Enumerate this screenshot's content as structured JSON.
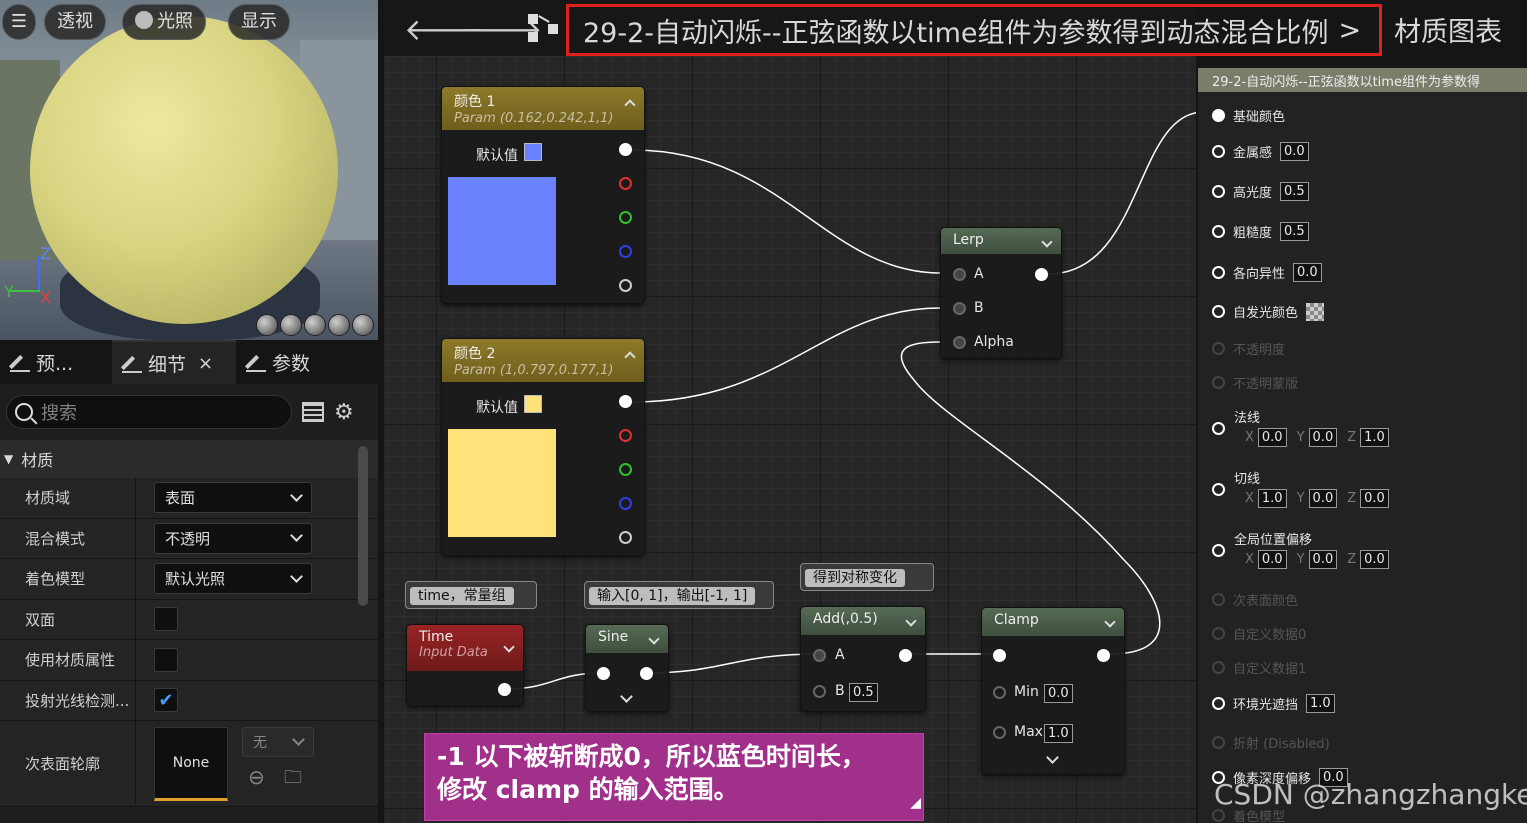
{
  "viewport": {
    "buttons": [
      "透视",
      "光照",
      "显示"
    ],
    "axis": {
      "z": "Z",
      "y": "Y",
      "x": "X"
    }
  },
  "panel": {
    "tabs": [
      {
        "label": "预..."
      },
      {
        "label": "细节"
      },
      {
        "label": "参数"
      }
    ],
    "search_placeholder": "搜索",
    "section": "材质",
    "props": [
      {
        "label": "材质域",
        "value": "表面"
      },
      {
        "label": "混合模式",
        "value": "不透明"
      },
      {
        "label": "着色模型",
        "value": "默认光照"
      },
      {
        "label": "双面",
        "checked": false
      },
      {
        "label": "使用材质属性",
        "checked": false
      },
      {
        "label": "投射光线检测...",
        "checked": true
      },
      {
        "label": "次表面轮廓",
        "value": "None",
        "combo": "无"
      }
    ]
  },
  "topbar": {
    "breadcrumb": "29-2-自动闪烁--正弦函数以time组件为参数得到动态混合比例",
    "separator": ">",
    "graph_label": "材质图表"
  },
  "nodes": {
    "color1": {
      "title": "颜色 1",
      "subtitle": "Param (0.162,0.242,1,1)",
      "default_label": "默认值",
      "color": "#6b82ff"
    },
    "color2": {
      "title": "颜色 2",
      "subtitle": "Param (1,0.797,0.177,1)",
      "default_label": "默认值",
      "color": "#ffe37a"
    },
    "lerp": {
      "title": "Lerp",
      "pins": [
        "A",
        "B",
        "Alpha"
      ]
    },
    "time": {
      "title": "Time",
      "subtitle": "Input Data",
      "comment": "time，常量组"
    },
    "sine": {
      "title": "Sine",
      "comment": "输入[0, 1]，输出[-1, 1]"
    },
    "add": {
      "title": "Add(,0.5)",
      "comment": "得到对称变化",
      "pin_a": "A",
      "pin_b": "B",
      "b_value": "0.5"
    },
    "clamp": {
      "title": "Clamp",
      "min_label": "Min",
      "min_value": "0.0",
      "max_label": "Max",
      "max_value": "1.0"
    }
  },
  "result": {
    "title": "29-2-自动闪烁--正弦函数以time组件为参数得",
    "pins": [
      {
        "label": "基础颜色"
      },
      {
        "label": "金属感",
        "value": "0.0"
      },
      {
        "label": "高光度",
        "value": "0.5"
      },
      {
        "label": "粗糙度",
        "value": "0.5"
      },
      {
        "label": "各向异性",
        "value": "0.0"
      },
      {
        "label": "自发光颜色"
      },
      {
        "label": "不透明度"
      },
      {
        "label": "不透明蒙版"
      },
      {
        "label": "法线",
        "vec": [
          "0.0",
          "0.0",
          "1.0"
        ]
      },
      {
        "label": "切线",
        "vec": [
          "1.0",
          "0.0",
          "0.0"
        ]
      },
      {
        "label": "全局位置偏移",
        "vec": [
          "0.0",
          "0.0",
          "0.0"
        ]
      },
      {
        "label": "次表面颜色"
      },
      {
        "label": "自定义数据0"
      },
      {
        "label": "自定义数据1"
      },
      {
        "label": "环境光遮挡",
        "value": "1.0"
      },
      {
        "label": "折射 (Disabled)"
      },
      {
        "label": "像素深度偏移",
        "value": "0.0"
      },
      {
        "label": "着色模型"
      }
    ],
    "vec_axes": [
      "X",
      "Y",
      "Z"
    ]
  },
  "note": {
    "line1": "-1 以下被斩断成0，所以蓝色时间长，",
    "line2": "修改 clamp 的输入范围。"
  },
  "watermark": "CSDN @zhangzhangkeji"
}
